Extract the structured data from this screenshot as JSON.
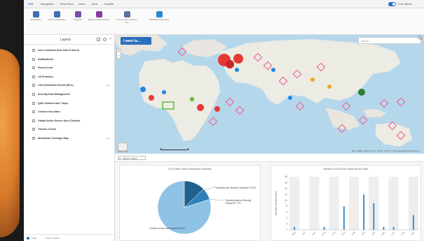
{
  "ribbon_tabs": [
    "eTA",
    "Navigation",
    "Pick Plans",
    "Draw",
    "Tools",
    "Transfer"
  ],
  "toggle_label": "Full Labels",
  "ribbon_tools": [
    {
      "icon": "bookmark-icon",
      "label": "Bookmarks"
    },
    {
      "icon": "grid-icon",
      "label": "Grid & Coordinates"
    },
    {
      "icon": "pin-icon",
      "label": "Pinpoint"
    },
    {
      "icon": "folder-icon",
      "label": "Read Location & Open"
    },
    {
      "icon": "edit-icon",
      "label": "Find Location & Open Info"
    },
    {
      "icon": "chart-icon",
      "label": "Risk Based Summary"
    }
  ],
  "layers": {
    "title": "Layers",
    "items": [
      {
        "label": "User Locations (less than 5 hours)",
        "meta": ""
      },
      {
        "label": "Notifications",
        "meta": ""
      },
      {
        "label": "Flood Count",
        "meta": ""
      },
      {
        "label": "US Premises",
        "meta": ""
      },
      {
        "label": "eTA Destination Events (Recu",
        "meta": "more"
      },
      {
        "label": "Security Risk Management",
        "meta": ""
      },
      {
        "label": "QUIC Incident last 7 days",
        "meta": ""
      },
      {
        "label": "Chinese Securities",
        "meta": ""
      },
      {
        "label": "Global Active Secure Alert (Travelle",
        "meta": ""
      },
      {
        "label": "Traveler Center",
        "meta": ""
      },
      {
        "label": "Worldwide Coverage Map",
        "meta": "more"
      }
    ],
    "footer": [
      "Layer",
      "Tools & Layers"
    ]
  },
  "map": {
    "want_button": "I want to...",
    "search_placeholder": "Search",
    "basemap_label": "Basemap",
    "attribution": "Esri, HERE, Garmin, FAO, NOAA, USGS, © OpenStreetMap contributors"
  },
  "dashboard": {
    "select_label": "Select Travel",
    "pie_title": "eTA Travel Travel Clearance Summary",
    "bar_title": "Number of eTA DOS Users by ISO Date"
  },
  "chart_data": [
    {
      "type": "pie",
      "title": "eTA Travel Travel Clearance Summary",
      "slices": [
        {
          "label": "Travelling with Security Clearance",
          "value": 12.8
        },
        {
          "label": "Travelling without Security Clearance",
          "value": 7.2
        },
        {
          "label": "Cleared at Due Date Address",
          "value": 80.0
        }
      ],
      "slice_labels": [
        "Travelling with Security Clearance 12.8%",
        "Travelling without Security Clearance 7.2%",
        "Cleared at Due Date Address 80.0%"
      ],
      "colors": [
        "#1f5f8b",
        "#2f7fb8",
        "#8fc3e6"
      ]
    },
    {
      "type": "bar",
      "title": "Number of eTA DOS Users by ISO Date",
      "ylabel": "Number of eTA Users",
      "ylim": [
        0,
        18
      ],
      "yticks": [
        0,
        2,
        4,
        6,
        8,
        10,
        12,
        14,
        16,
        18
      ],
      "categories": [
        "2019",
        "2/8",
        "2/11",
        "2/14",
        "2/16",
        "2/19",
        "2/20",
        "2/21",
        "2/25",
        "2/26",
        "2/27",
        "2/28",
        "3/01"
      ],
      "values": [
        1,
        0,
        0,
        1,
        0,
        8,
        0,
        12,
        9,
        1,
        1,
        0,
        5
      ],
      "color": "#3b8fd0"
    }
  ]
}
